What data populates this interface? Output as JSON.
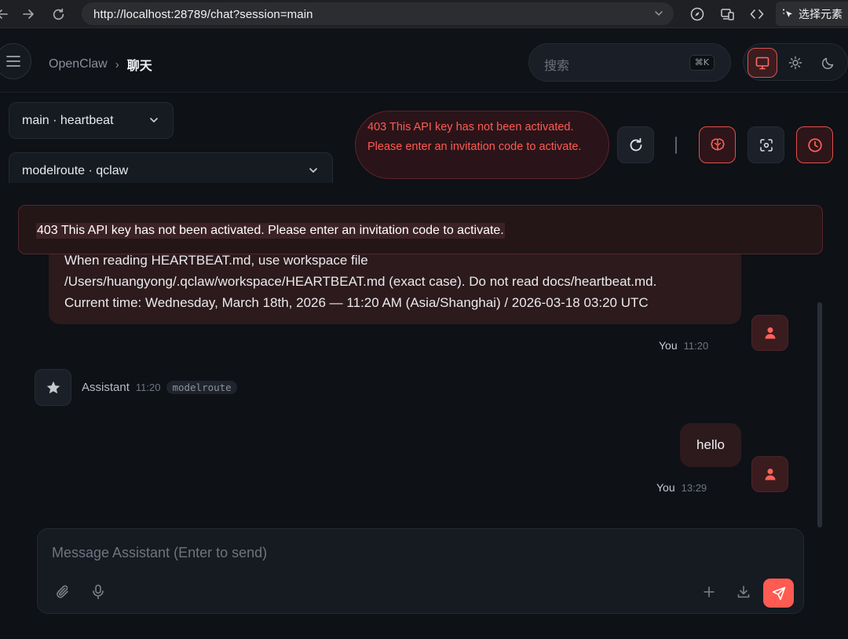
{
  "browser": {
    "url": "http://localhost:28789/chat?session=main",
    "select_element_label": "选择元素"
  },
  "header": {
    "breadcrumb_root": "OpenClaw",
    "breadcrumb_separator": "›",
    "breadcrumb_current": "聊天",
    "search_placeholder": "搜索",
    "search_shortcut": "⌘K"
  },
  "controls": {
    "session_select": "main · heartbeat",
    "model_select": "modelroute · qclaw",
    "error_bubble": "403 This API key has not been activated. Please enter an invitation code to activate."
  },
  "banner": {
    "text": "403 This API key has not been activated. Please enter an invitation code to activate."
  },
  "messages": {
    "user_first": {
      "lines": [
        "When reading HEARTBEAT.md, use workspace file",
        "/Users/huangyong/.qclaw/workspace/HEARTBEAT.md (exact case). Do not read docs/heartbeat.md.",
        "Current time: Wednesday, March 18th, 2026 — 11:20 AM (Asia/Shanghai) / 2026-03-18 03:20 UTC"
      ],
      "author": "You",
      "time": "11:20"
    },
    "assistant": {
      "name": "Assistant",
      "time": "11:20",
      "tag": "modelroute"
    },
    "user_second": {
      "text": "hello",
      "author": "You",
      "time": "13:29"
    }
  },
  "composer": {
    "placeholder": "Message Assistant (Enter to send)"
  },
  "colors": {
    "accent": "#ff5b52",
    "background": "#0e1116",
    "error_text": "#ff5a52"
  }
}
